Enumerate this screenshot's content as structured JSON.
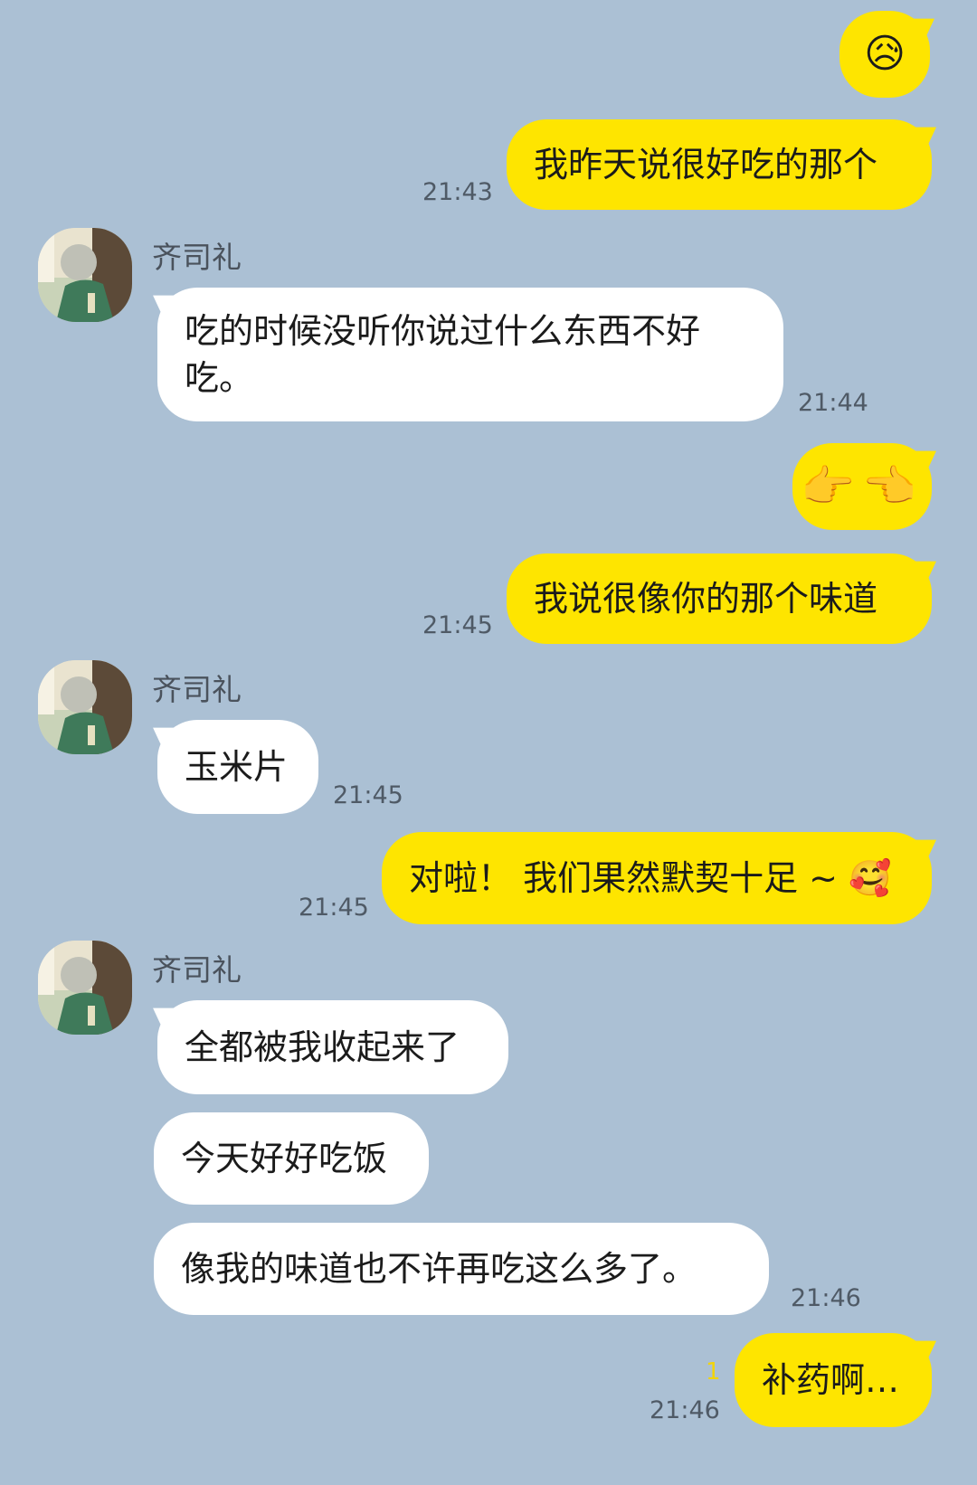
{
  "contact": {
    "name": "齐司礼"
  },
  "messages": [
    {
      "id": "m1",
      "text": "😥",
      "time": ""
    },
    {
      "id": "m2",
      "text": "我昨天说很好吃的那个",
      "time": "21:43"
    },
    {
      "id": "m3",
      "text_line1": "吃的时候没听你说过什么东西不好",
      "text_line2": "吃。",
      "time": "21:44"
    },
    {
      "id": "m4",
      "text": "👉👈",
      "time": ""
    },
    {
      "id": "m5",
      "text": "我说很像你的那个味道",
      "time": "21:45"
    },
    {
      "id": "m6",
      "text": "玉米片",
      "time": "21:45"
    },
    {
      "id": "m7",
      "text": "对啦！ 我们果然默契十足 ~ 🥰",
      "time": "21:45"
    },
    {
      "id": "m8",
      "text": "全都被我收起来了",
      "time": ""
    },
    {
      "id": "m9",
      "text": "今天好好吃饭",
      "time": ""
    },
    {
      "id": "m10",
      "text": "像我的味道也不许再吃这么多了。",
      "time": "21:46"
    },
    {
      "id": "m11",
      "text": "补药啊…",
      "time": "21:46",
      "unread": "1"
    }
  ],
  "colors": {
    "background": "#abc0d4",
    "mine_bubble": "#fee500",
    "theirs_bubble": "#ffffff",
    "time_text": "#4f5a66",
    "unread_text": "#f2d40a"
  },
  "icons": {
    "avatar": "avatar-illustration-icon"
  }
}
